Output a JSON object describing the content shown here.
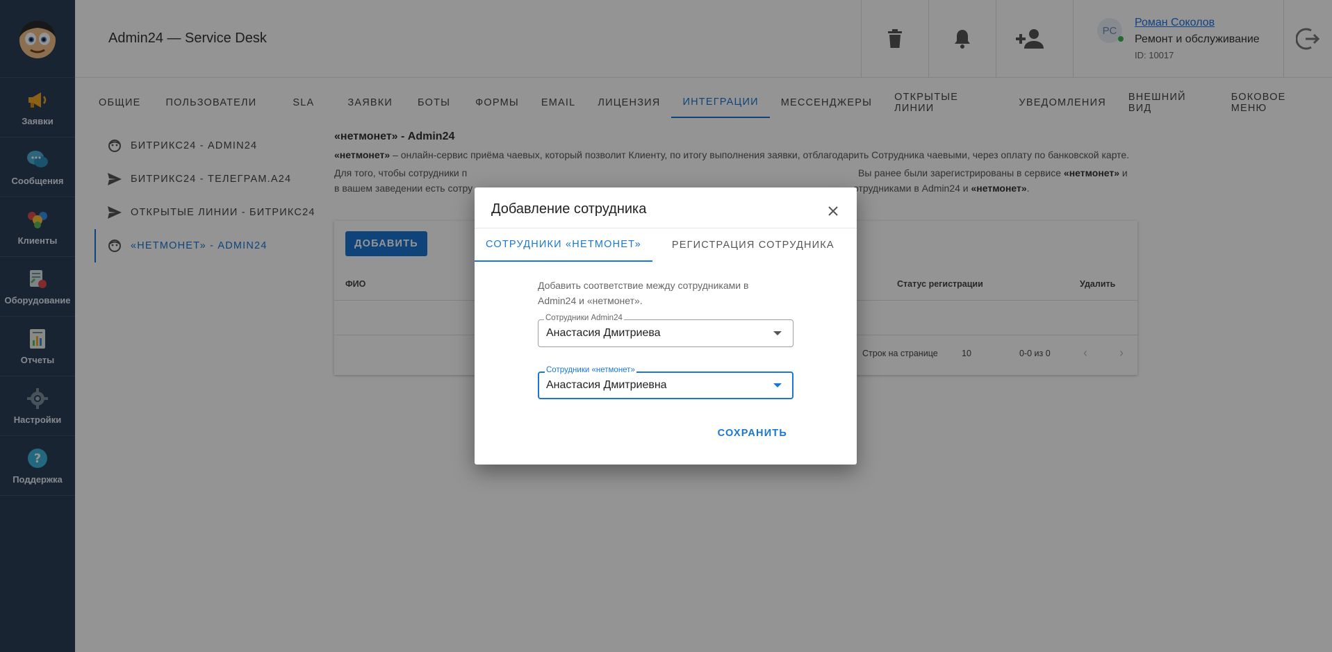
{
  "app": {
    "title": "Admin24 — Service Desk"
  },
  "sidebar": {
    "items": [
      {
        "label": "Заявки",
        "icon": "megaphone-icon"
      },
      {
        "label": "Сообщения",
        "icon": "chat-bubbles-icon"
      },
      {
        "label": "Клиенты",
        "icon": "people-icon"
      },
      {
        "label": "Оборудование",
        "icon": "equipment-icon"
      },
      {
        "label": "Отчеты",
        "icon": "report-icon"
      },
      {
        "label": "Настройки",
        "icon": "gear-icon"
      },
      {
        "label": "Поддержка",
        "icon": "help-icon"
      }
    ]
  },
  "user": {
    "initials": "РС",
    "name": "Роман Соколов",
    "org": "Ремонт и обслуживание",
    "id": "ID: 10017"
  },
  "tabs": [
    "ОБЩИЕ",
    "ПОЛЬЗОВАТЕЛИ",
    "SLA",
    "ЗАЯВКИ",
    "БОТЫ",
    "ФОРМЫ",
    "EMAIL",
    "ЛИЦЕНЗИЯ",
    "ИНТЕГРАЦИИ",
    "МЕССЕНДЖЕРЫ",
    "ОТКРЫТЫЕ ЛИНИИ",
    "УВЕДОМЛЕНИЯ",
    "ВНЕШНИЙ ВИД",
    "БОКОВОЕ МЕНЮ"
  ],
  "active_tab": "ИНТЕГРАЦИИ",
  "submenu": [
    {
      "label": "БИТРИКС24 - ADMIN24",
      "icon": "face-icon"
    },
    {
      "label": "БИТРИКС24 - ТЕЛЕГРАМ.А24",
      "icon": "send-icon"
    },
    {
      "label": "ОТКРЫТЫЕ ЛИНИИ - БИТРИКС24",
      "icon": "send-icon"
    },
    {
      "label": "«НЕТМОНЕТ» - ADMIN24",
      "icon": "face-icon"
    }
  ],
  "content": {
    "title": "«нетмонет» - Admin24",
    "p1_bold": "«нетмонет»",
    "p1_rest": " – онлайн-сервис приёма чаевых, который позволит Клиенту, по итогу выполнения заявки, отблагодарить Сотрудника чаевыми, через оплату по банковской карте.",
    "p2_a": "Для того, чтобы сотрудники п",
    "p2_b": "Вы ранее были зарегистрированы в сервисе ",
    "p2_b_bold": "«нетмонет»",
    "p2_c": " и",
    "p3_a": "в вашем заведении есть сотру",
    "p3_b": "отрудниками в Admin24 и ",
    "p3_bold": "«нетмонет»",
    "p3_end": ".",
    "add_button": "ДОБАВИТЬ",
    "columns": {
      "fio": "ФИО",
      "status": "Статус регистрации",
      "delete": "Удалить"
    },
    "rows_per_page_label": "Строк на странице",
    "rows_per_page": "10",
    "range": "0-0 из 0"
  },
  "dialog": {
    "title": "Добавление сотрудника",
    "tabs": [
      "СОТРУДНИКИ «НЕТМОНЕТ»",
      "РЕГИСТРАЦИЯ СОТРУДНИКА"
    ],
    "description": "Добавить соответствие между сотрудниками в Admin24 и «нетмонет».",
    "field1": {
      "label": "Сотрудники Admin24",
      "value": "Анастасия Дмитриева"
    },
    "field2": {
      "label": "Сотрудники «нетмонет»",
      "value": "Анастасия Дмитриевна"
    },
    "save": "СОХРАНИТЬ"
  },
  "colors": {
    "accent": "#1976d2",
    "sidebar": "#2b3f56",
    "overlay": "rgba(0,0,0,0.42)"
  }
}
